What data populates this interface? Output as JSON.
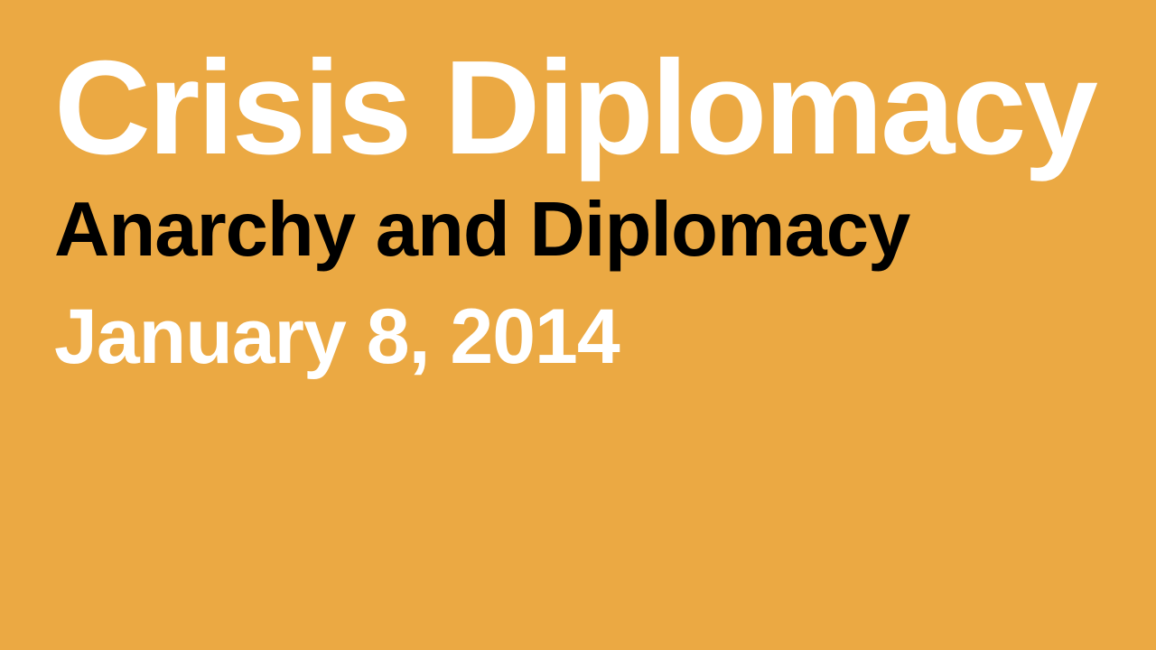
{
  "slide": {
    "title": "Crisis Diplomacy",
    "subtitle": "Anarchy and Diplomacy",
    "date": "January 8, 2014"
  },
  "colors": {
    "background": "#eba943",
    "title": "#ffffff",
    "subtitle": "#000000",
    "date": "#ffffff"
  }
}
